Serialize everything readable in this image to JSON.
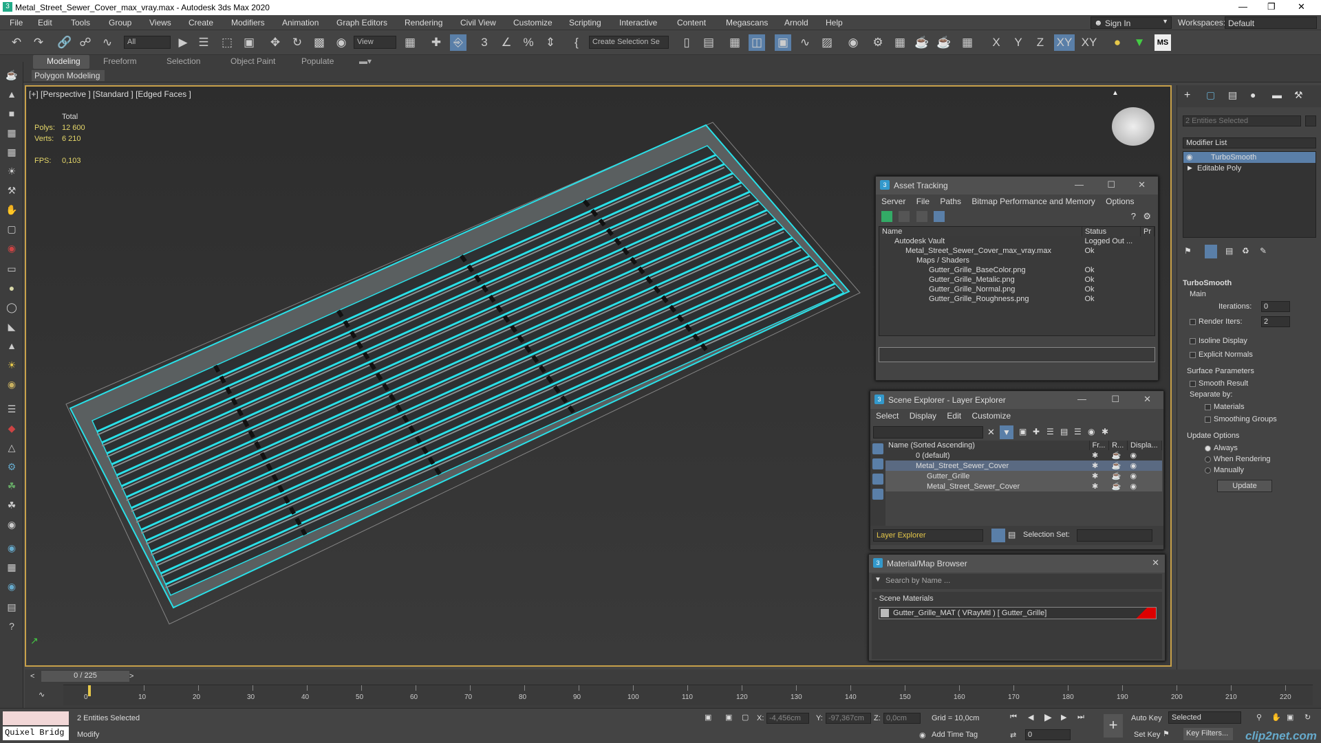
{
  "window": {
    "title": "Metal_Street_Sewer_Cover_max_vray.max - Autodesk 3ds Max 2020"
  },
  "menu": [
    "File",
    "Edit",
    "Tools",
    "Group",
    "Views",
    "Create",
    "Modifiers",
    "Animation",
    "Graph Editors",
    "Rendering",
    "Civil View",
    "Customize",
    "Scripting",
    "Interactive",
    "Content",
    "Megascans",
    "Arnold",
    "Help"
  ],
  "account": {
    "sign_in": "Sign In",
    "workspaces_label": "Workspaces:",
    "workspace": "Default"
  },
  "toolbar": {
    "filter": "All",
    "refcoord": "View",
    "selection_set": "Create Selection Se",
    "axes": [
      "X",
      "Y",
      "Z",
      "XY",
      "XY"
    ]
  },
  "ribbon": {
    "tabs": [
      "Modeling",
      "Freeform",
      "Selection",
      "Object Paint",
      "Populate"
    ],
    "sub": "Polygon Modeling"
  },
  "viewport": {
    "label": "[+] [Perspective ] [Standard ] [Edged Faces ]",
    "stats": {
      "total": "Total",
      "polys_label": "Polys:",
      "polys": "12 600",
      "verts_label": "Verts:",
      "verts": "6 210",
      "fps_label": "FPS:",
      "fps": "0,103"
    }
  },
  "asset_tracking": {
    "title": "Asset Tracking",
    "menu": [
      "Server",
      "File",
      "Paths",
      "Bitmap Performance and Memory",
      "Options"
    ],
    "columns": [
      "Name",
      "Status",
      "Pr"
    ],
    "rows": [
      {
        "name": "Autodesk Vault",
        "status": "Logged Out ..."
      },
      {
        "name": "Metal_Street_Sewer_Cover_max_vray.max",
        "status": "Ok"
      },
      {
        "name": "Maps / Shaders",
        "status": ""
      },
      {
        "name": "Gutter_Grille_BaseColor.png",
        "status": "Ok"
      },
      {
        "name": "Gutter_Grille_Metalic.png",
        "status": "Ok"
      },
      {
        "name": "Gutter_Grille_Normal.png",
        "status": "Ok"
      },
      {
        "name": "Gutter_Grille_Roughness.png",
        "status": "Ok"
      }
    ]
  },
  "scene_explorer": {
    "title": "Scene Explorer - Layer Explorer",
    "menu": [
      "Select",
      "Display",
      "Edit",
      "Customize"
    ],
    "columns": [
      "Name (Sorted Ascending)",
      "Fr...",
      "R...",
      "Displa..."
    ],
    "rows": [
      {
        "name": "0 (default)"
      },
      {
        "name": "Metal_Street_Sewer_Cover"
      },
      {
        "name": "Gutter_Grille"
      },
      {
        "name": "Metal_Street_Sewer_Cover"
      }
    ],
    "footer_dropdown": "Layer Explorer",
    "selection_set_label": "Selection Set:"
  },
  "material_browser": {
    "title": "Material/Map Browser",
    "search_placeholder": "Search by Name ...",
    "section": "- Scene Materials",
    "item": "Gutter_Grille_MAT ( VRayMtl ) [ Gutter_Grille]"
  },
  "command_panel": {
    "selected": "2 Entities Selected",
    "modifier_list": "Modifier List",
    "stack": [
      "TurboSmooth",
      "Editable Poly"
    ],
    "rollout": "TurboSmooth",
    "main": "Main",
    "iterations_label": "Iterations:",
    "iterations": "0",
    "render_iters_label": "Render Iters:",
    "render_iters": "2",
    "isoline": "Isoline Display",
    "explicit": "Explicit Normals",
    "surface": "Surface Parameters",
    "smooth_result": "Smooth Result",
    "separate_by": "Separate by:",
    "materials": "Materials",
    "smoothing_groups": "Smoothing Groups",
    "update_options": "Update Options",
    "always": "Always",
    "when_rendering": "When Rendering",
    "manually": "Manually",
    "update": "Update"
  },
  "timeline": {
    "frame": "0 / 225",
    "ticks": [
      "0",
      "10",
      "20",
      "30",
      "40",
      "50",
      "60",
      "70",
      "80",
      "90",
      "100",
      "110",
      "120",
      "130",
      "140",
      "150",
      "160",
      "170",
      "180",
      "190",
      "200",
      "210",
      "220"
    ]
  },
  "status": {
    "maxscript": "Quixel Bridg",
    "entities": "2 Entities Selected",
    "mode": "Modify",
    "x_label": "X:",
    "x": "-4,456cm",
    "y_label": "Y:",
    "y": "-97,367cm",
    "z_label": "Z:",
    "z": "0,0cm",
    "grid": "Grid = 10,0cm",
    "add_time_tag": "Add Time Tag",
    "auto_key": "Auto Key",
    "set_key": "Set Key",
    "selected": "Selected",
    "key_filters": "Key Filters...",
    "frame_value": "0"
  },
  "watermark": "clip2net.com"
}
